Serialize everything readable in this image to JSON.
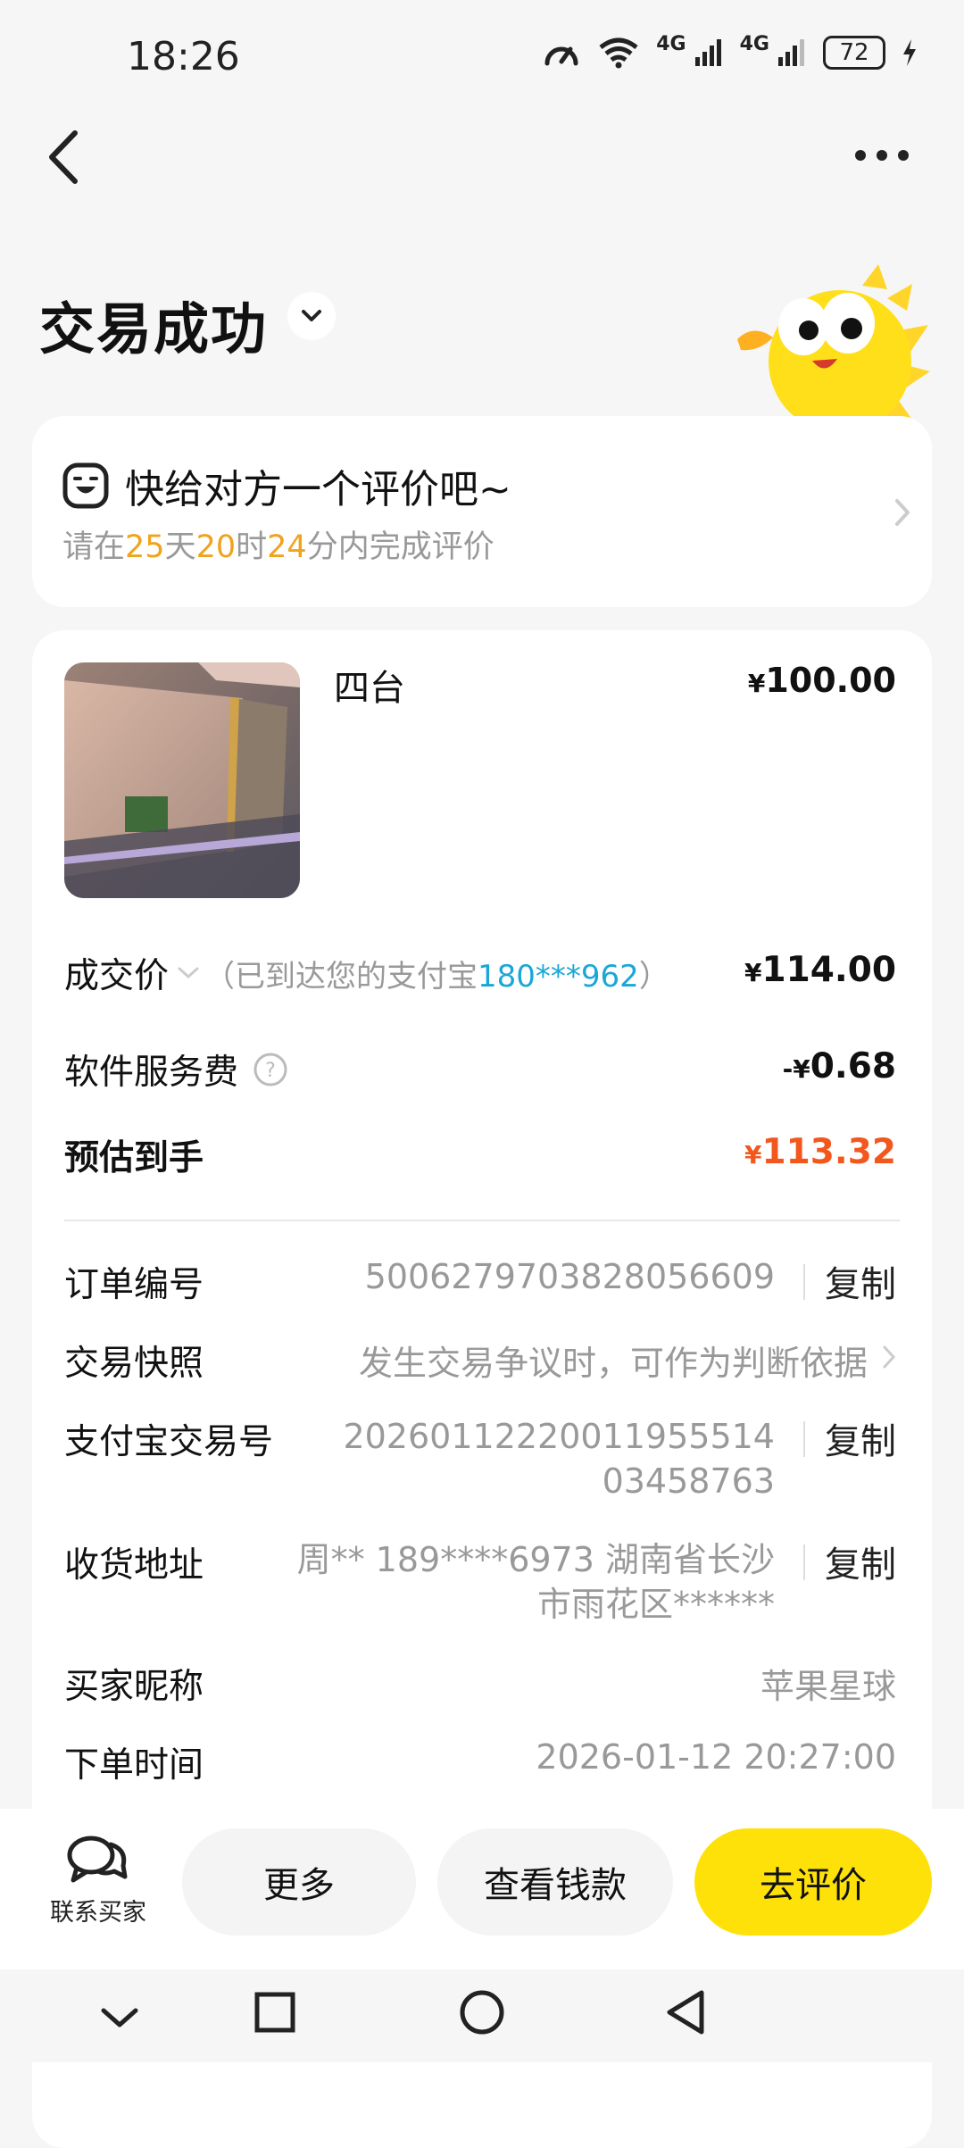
{
  "status_bar": {
    "time": "18:26",
    "network1": "4G",
    "network2": "4G",
    "battery": "72"
  },
  "header": {
    "title": "交易成功"
  },
  "review_card": {
    "title": "快给对方一个评价吧~",
    "sub_prefix": "请在",
    "days": "25",
    "days_unit": "天",
    "hours": "20",
    "hours_unit": "时",
    "minutes": "24",
    "sub_suffix": "分内完成评价"
  },
  "item": {
    "name": "四台",
    "price": "100.00",
    "currency": "¥"
  },
  "price_rows": {
    "deal_label": "成交价",
    "deal_note_prefix": "（已到达您的支付宝",
    "deal_note_account": "180***962",
    "deal_note_suffix": "）",
    "deal_value": "114.00",
    "fee_label": "软件服务费",
    "fee_prefix": "-",
    "fee_value": "0.68",
    "est_label": "预估到手",
    "est_value": "113.32"
  },
  "details": {
    "order_no_label": "订单编号",
    "order_no": "5006279703828056609",
    "copy": "复制",
    "snapshot_label": "交易快照",
    "snapshot_value": "发生交易争议时，可作为判断依据",
    "alipay_label": "支付宝交易号",
    "alipay_line1": "20260112220011955514",
    "alipay_line2": "03458763",
    "address_label": "收货地址",
    "address_line1": "周** 189****6973 湖南省长沙",
    "address_line2": "市雨花区******",
    "buyer_label": "买家昵称",
    "buyer_value": "苹果星球",
    "order_time_label": "下单时间",
    "order_time_value": "2026-01-12 20:27:00"
  },
  "bottom": {
    "contact": "联系买家",
    "more": "更多",
    "view_money": "查看钱款",
    "review": "去评价"
  },
  "colors": {
    "accent": "#ffe10a",
    "orange": "#f2581d",
    "countdown": "#f0a31c",
    "link": "#1aa7d8"
  }
}
